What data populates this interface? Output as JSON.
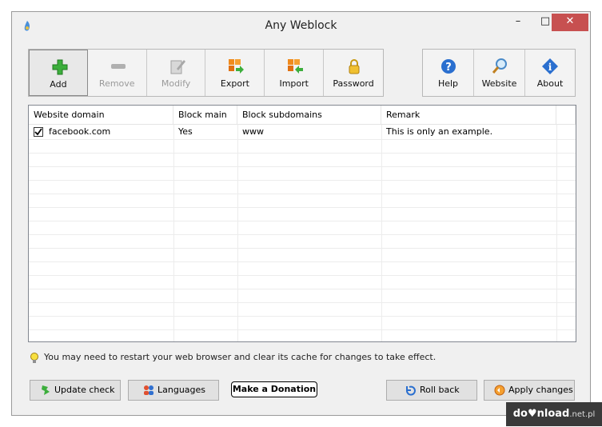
{
  "window": {
    "title": "Any Weblock",
    "controls": {
      "minimize": "–",
      "maximize": "□",
      "close": "✕"
    }
  },
  "toolbar": {
    "left": [
      {
        "label": "Add",
        "icon": "add-icon"
      },
      {
        "label": "Remove",
        "icon": "remove-icon"
      },
      {
        "label": "Modify",
        "icon": "modify-icon"
      },
      {
        "label": "Export",
        "icon": "export-icon"
      },
      {
        "label": "Import",
        "icon": "import-icon"
      },
      {
        "label": "Password",
        "icon": "lock-icon"
      }
    ],
    "right": [
      {
        "label": "Help",
        "icon": "help-icon"
      },
      {
        "label": "Website",
        "icon": "magnifier-icon"
      },
      {
        "label": "About",
        "icon": "info-icon"
      }
    ]
  },
  "list": {
    "columns": [
      "Website domain",
      "Block main",
      "Block subdomains",
      "Remark"
    ],
    "rows": [
      {
        "checked": true,
        "domain": "facebook.com",
        "block_main": "Yes",
        "block_subdomains": "www",
        "remark": "This is only an example."
      }
    ]
  },
  "hint": "You may need to restart your web browser and clear its cache for changes to take effect.",
  "buttons": {
    "update_check": "Update check",
    "languages": "Languages",
    "donate": "Make a Donation",
    "roll_back": "Roll back",
    "apply_changes": "Apply changes"
  },
  "watermark": {
    "main": "do♥nload",
    "suffix": ".net.pl"
  },
  "colors": {
    "close_button": "#c75050",
    "add_green": "#3cae3c",
    "export_orange": "#f08a1c",
    "help_blue": "#2a6fcf"
  }
}
